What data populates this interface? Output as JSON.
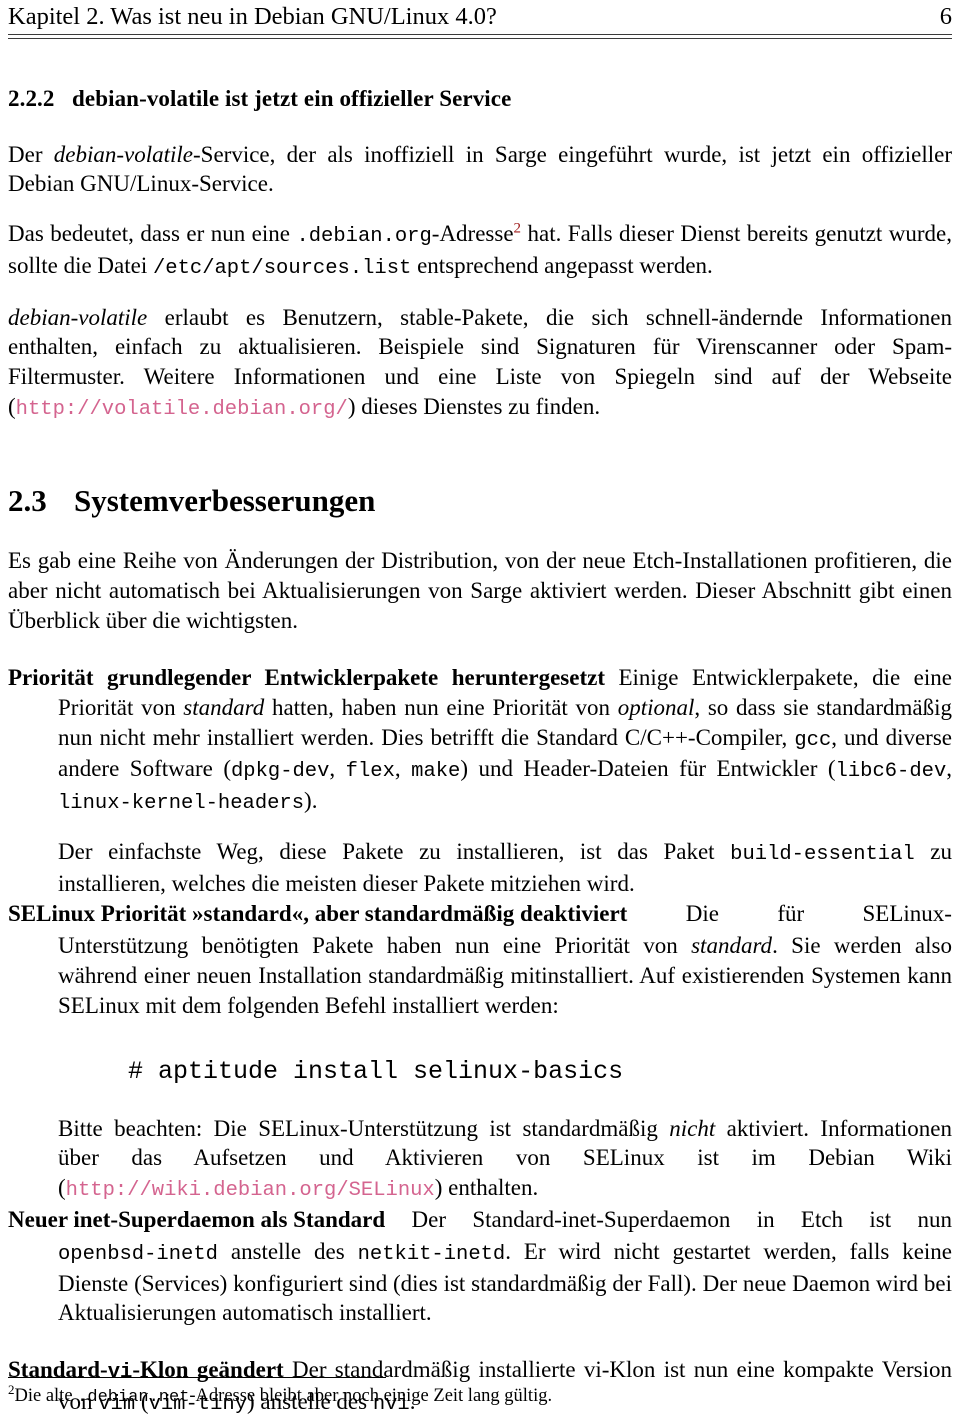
{
  "header": {
    "chapter_title": "Kapitel 2. Was ist neu in Debian GNU/Linux 4.0?",
    "page_number": "6"
  },
  "colors": {
    "link": "#d4648f",
    "footnote_marker": "#9e1b1b",
    "text": "#000000",
    "rule": "#3a3a3a"
  },
  "subsection_222": {
    "number": "2.2.2",
    "title": "debian-volatile ist jetzt ein offizieller Service",
    "para1": {
      "t1": "Der ",
      "em1": "debian-volatile",
      "t2": "-Service, der als inoffiziell in Sarge eingeführt wurde, ist jetzt ein offizieller Debian GNU/Linux-Service."
    },
    "para2": {
      "t1": "Das bedeutet, dass er nun eine ",
      "code1": ".debian.org",
      "t2": "-Adresse",
      "fn": "2",
      "t3": " hat. Falls dieser Dienst bereits genutzt wurde, sollte die Datei ",
      "code2": "/etc/apt/sources.list",
      "t4": " entsprechend angepasst werden."
    },
    "para3": {
      "em1": "debian-volatile",
      "t1": " erlaubt es Benutzern, stable-Pakete, die sich schnell-ändernde Informationen enthalten, einfach zu aktualisieren. Beispiele sind Signaturen für Virenscanner oder Spam-Filtermuster. Weitere Informationen und eine Liste von Spiegeln sind auf der Webseite (",
      "url": "http://volatile.debian.org/",
      "t2": ") dieses Dienstes zu finden."
    }
  },
  "section_23": {
    "number": "2.3",
    "title": "Systemverbesserungen",
    "intro": "Es gab eine Reihe von Änderungen der Distribution, von der neue Etch-Installationen profitieren, die aber nicht automatisch bei Aktualisierungen von Sarge aktiviert werden. Dieser Abschnitt gibt einen Überblick über die wichtigsten."
  },
  "item_prioritaet": {
    "heading": "Priorität grundlegender Entwicklerpakete heruntergesetzt",
    "t1": " Einige Entwicklerpakete, die eine Priorität von ",
    "em1": "standard",
    "t2": " hatten, haben nun eine Priorität von ",
    "em2": "optional",
    "t3": ", so dass sie standardmäßig nun nicht mehr installiert werden. Dies betrifft die Standard C/C++-Compiler, ",
    "code1": "gcc",
    "t4": ", und diverse andere Software (",
    "code2": "dpkg-dev",
    "t5": ", ",
    "code3": "flex",
    "t6": ", ",
    "code4": "make",
    "t7": ") und Header-Dateien für Entwickler (",
    "code5": "libc6-dev",
    "t8": ", ",
    "code6": "linux-kernel-headers",
    "t9": ")."
  },
  "item_prioritaet_p2": {
    "t1": "Der einfachste Weg, diese Pakete zu installieren, ist das Paket ",
    "code1": "build-essential",
    "t2": " zu installieren, welches die meisten dieser Pakete mitziehen wird."
  },
  "item_selinux": {
    "heading": "SELinux Priorität »standard«, aber standardmäßig deaktiviert",
    "line1_w1": "Die",
    "line1_w2": "für",
    "line1_w3": "SELinux-",
    "t1": "Unterstützung benötigten Pakete haben nun eine Priorität von ",
    "em1": "standard",
    "t2": ". Sie werden also während einer neuen Installation standardmäßig mitinstalliert. Auf existierenden Systemen kann SELinux mit dem folgenden Befehl installiert werden:",
    "code_block": "# aptitude install selinux-basics",
    "p2_t1": "Bitte beachten: Die SELinux-Unterstützung ist standardmäßig ",
    "p2_em1": "nicht",
    "p2_t2": " aktiviert. Informationen über das Aufsetzen und Aktivieren von SELinux ist im Debian Wiki (",
    "p2_url": "http://wiki.debian.org/SELinux",
    "p2_t3": ") enthalten."
  },
  "item_inetd": {
    "heading": "Neuer inet-Superdaemon als Standard",
    "line1_w1": "Der",
    "line1_w2": "Standard-inet-Superdaemon",
    "line1_w3": "in",
    "line1_w4": "Etch",
    "line1_w5": "ist",
    "line1_w6": "nun",
    "code1": "openbsd-inetd",
    "t1": " anstelle des ",
    "code2": "netkit-inetd",
    "t2": ". Er wird nicht gestartet werden, falls keine Dienste (Services) konfiguriert sind (dies ist standardmäßig der Fall). Der neue Daemon wird bei Aktualisierungen automatisch installiert."
  },
  "item_vi": {
    "heading_a": "Standard-",
    "heading_code": "vi",
    "heading_b": "-Klon geändert",
    "t1": " Der standardmäßig installierte vi-Klon ist nun eine kompakte Version von ",
    "code1": "vim",
    "t2": " (",
    "code2": "vim-tiny",
    "t3": ") anstelle des ",
    "code3": "nvi",
    "t4": "."
  },
  "footnote": {
    "marker": "2",
    "t1": "Die alte ",
    "code1": ".debian.net",
    "t2": "-Adresse bleibt aber noch einige Zeit lang gültig."
  }
}
